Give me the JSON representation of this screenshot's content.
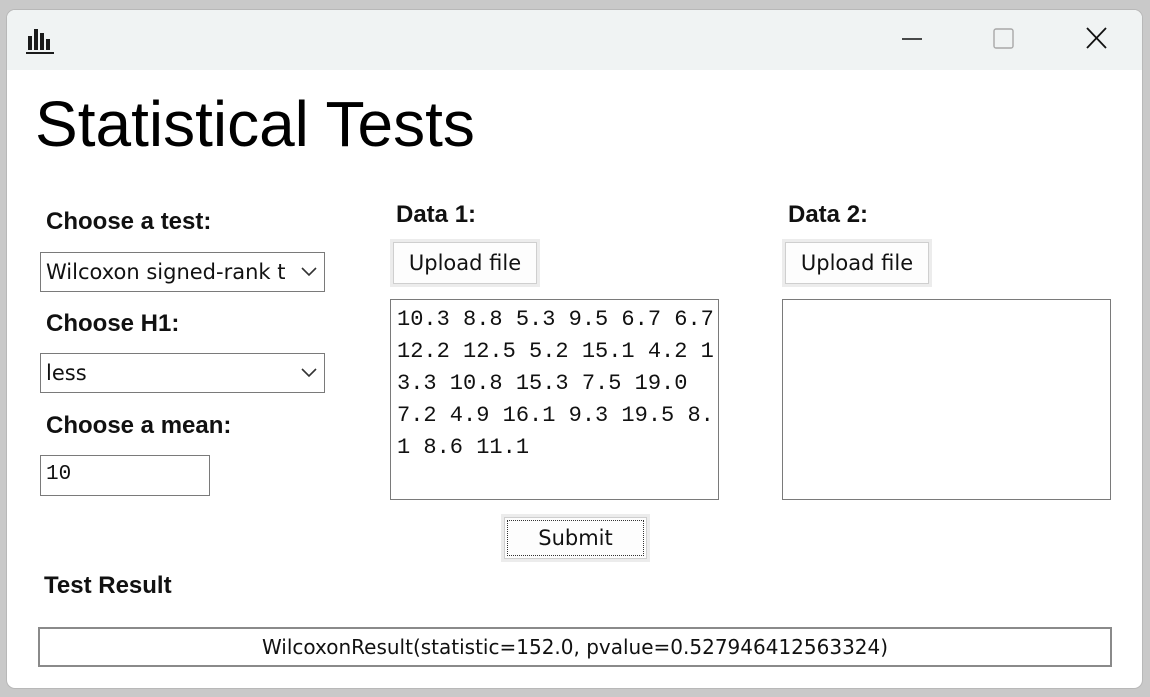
{
  "window": {
    "title": "Statistical Tests",
    "app_icon": "bar-chart-icon",
    "controls": [
      "minimize-icon",
      "maximize-icon",
      "close-icon"
    ]
  },
  "left_panel": {
    "test_label": "Choose a test:",
    "test_value": "Wilcoxon signed-rank test",
    "h1_label": "Choose H1:",
    "h1_value": "less",
    "mean_label": "Choose a mean:",
    "mean_value": "10"
  },
  "data1": {
    "label": "Data 1:",
    "upload_label": "Upload file",
    "content": "10.3 8.8 5.3 9.5 6.7 6.7 12.2 12.5 5.2 15.1 4.2 13.3 10.8 15.3 7.5 19.0 7.2 4.9 16.1 9.3 19.5 8.1 8.6 11.1"
  },
  "data2": {
    "label": "Data 2:",
    "upload_label": "Upload file",
    "content": ""
  },
  "submit_label": "Submit",
  "result": {
    "label": "Test Result",
    "value": "WilcoxonResult(statistic=152.0, pvalue=0.527946412563324)"
  }
}
